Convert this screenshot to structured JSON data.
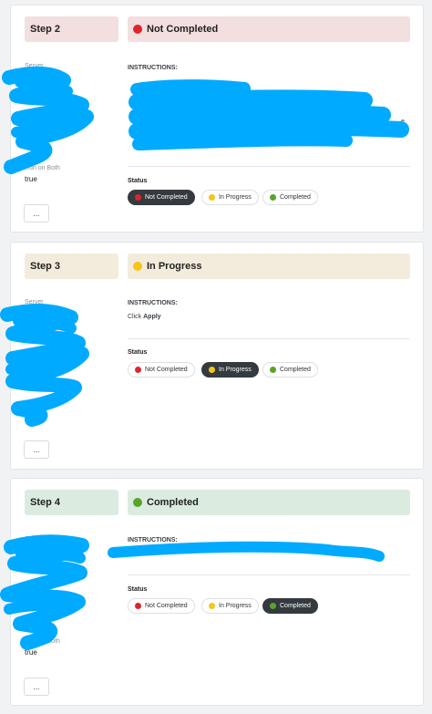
{
  "colors": {
    "not_completed_bg": "#f3dfdf",
    "in_progress_bg": "#f3ecdc",
    "completed_bg": "#dcebdf",
    "active_pill": "#343a40",
    "redaction": "#00aaff"
  },
  "steps": [
    {
      "step_label": "Step 2",
      "status_title": "Not Completed",
      "server_label": "Server",
      "run_label": "Run on Both",
      "run_value": "true",
      "more_label": "...",
      "instructions_label": "INSTRUCTIONS:",
      "bullets": [
        "•",
        "•"
      ],
      "partial_text": [
        "e",
        "p"
      ],
      "status_label": "Status",
      "options": [
        "Not Completed",
        "In Progress",
        "Completed"
      ],
      "selected": "Not Completed"
    },
    {
      "step_label": "Step 3",
      "status_title": "In Progress",
      "server_label": "Server",
      "more_label": "...",
      "instructions_label": "INSTRUCTIONS:",
      "instruction_prefix": "Click",
      "instruction_action": "Apply",
      "status_label": "Status",
      "options": [
        "Not Completed",
        "In Progress",
        "Completed"
      ],
      "selected": "In Progress"
    },
    {
      "step_label": "Step 4",
      "status_title": "Completed",
      "server_label": "Server",
      "run_label": "Run on Both",
      "run_value": "true",
      "more_label": "...",
      "instructions_label": "INSTRUCTIONS:",
      "status_label": "Status",
      "options": [
        "Not Completed",
        "In Progress",
        "Completed"
      ],
      "selected": "Completed"
    }
  ]
}
